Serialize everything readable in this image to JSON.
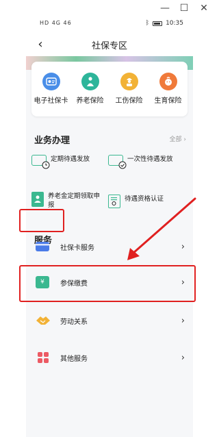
{
  "statusbar": {
    "signal": "HD 4G 46",
    "time": "10:35"
  },
  "nav": {
    "title": "社保专区"
  },
  "quick_grid": [
    {
      "label": "电子社保卡",
      "icon": "id-card-icon",
      "color": "#4a8ee8"
    },
    {
      "label": "养老保险",
      "icon": "elder-person-icon",
      "color": "#2db59a"
    },
    {
      "label": "工伤保险",
      "icon": "worker-icon",
      "color": "#f2b236"
    },
    {
      "label": "生育保险",
      "icon": "baby-icon",
      "color": "#f07a3a"
    }
  ],
  "business": {
    "title": "业务办理",
    "all_label": "全部 ›",
    "items": [
      {
        "label": "定期待遇发放",
        "icon": "card-clock-icon"
      },
      {
        "label": "一次性待遇发放",
        "icon": "card-check-icon"
      },
      {
        "label": "养老金定期领取申报",
        "icon": "document-person-icon"
      },
      {
        "label": "待遇资格认证",
        "icon": "certificate-icon"
      }
    ]
  },
  "services": {
    "title": "服务",
    "items": [
      {
        "label": "社保卡服务",
        "icon": "card-icon",
        "color": "#4a7be8"
      },
      {
        "label": "参保缴费",
        "icon": "yen-payment-icon",
        "color": "#3bb890"
      },
      {
        "label": "劳动关系",
        "icon": "handshake-icon",
        "color": "#f2b236"
      },
      {
        "label": "其他服务",
        "icon": "grid-icon",
        "color": "#ec5a64"
      }
    ]
  },
  "colors": {
    "accent_green": "#3bb890",
    "annotation_red": "#e02020"
  }
}
